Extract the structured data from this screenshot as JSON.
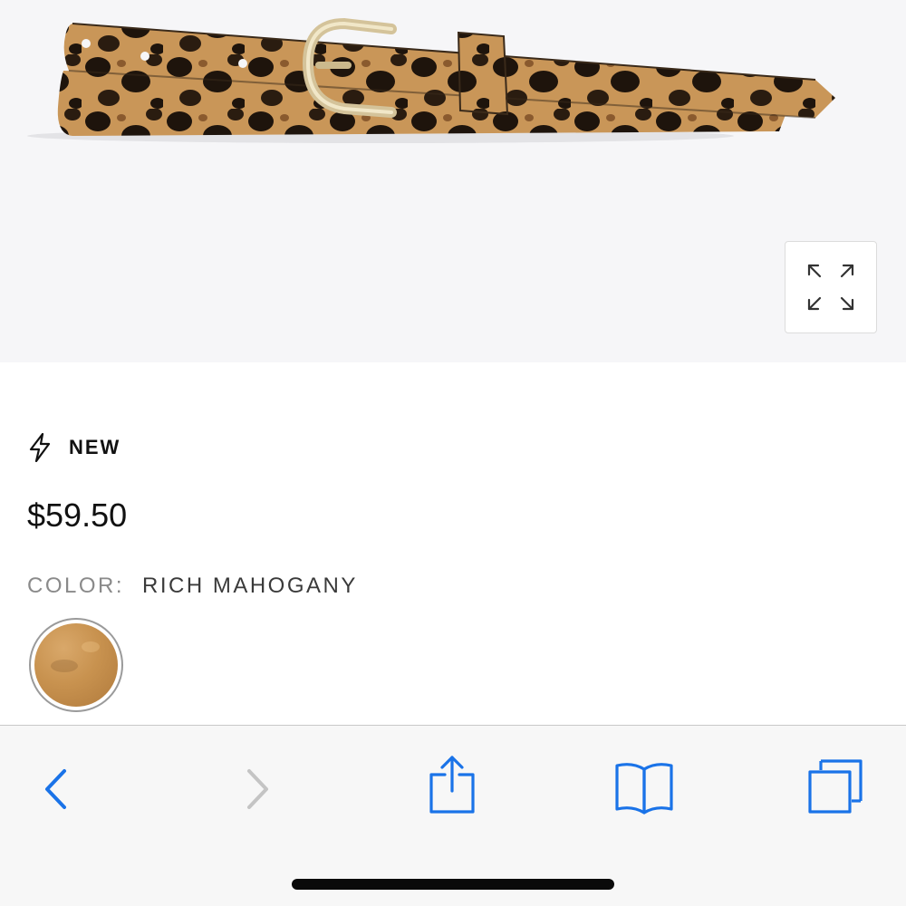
{
  "product": {
    "badge": "NEW",
    "price": "$59.50",
    "color_label": "COLOR:",
    "color_value": "RICH MAHOGANY"
  },
  "icons": {
    "zoom": "expand-arrows-icon",
    "badge": "lightning-bolt-icon",
    "back": "chevron-left-icon",
    "forward": "chevron-right-icon",
    "share": "share-icon",
    "bookmarks": "book-icon",
    "tabs": "tabs-icon"
  },
  "colors": {
    "toolbar_active": "#1a73e8",
    "toolbar_disabled": "#c4c4c4",
    "hero_bg": "#f6f6f8"
  },
  "toolbar": {
    "back_enabled": true,
    "forward_enabled": false
  }
}
